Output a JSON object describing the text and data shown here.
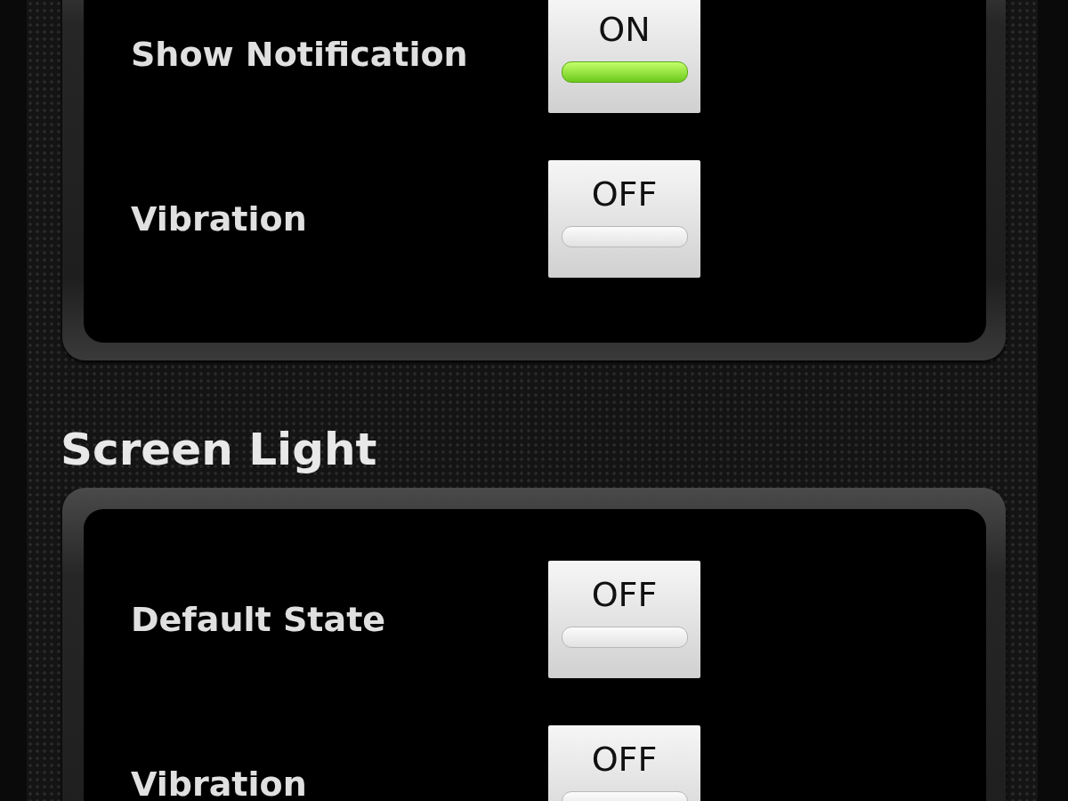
{
  "sections": [
    {
      "rows": [
        {
          "label": "Show Notification",
          "toggle_text": "ON",
          "on": true
        },
        {
          "label": "Vibration",
          "toggle_text": "OFF",
          "on": false
        }
      ]
    },
    {
      "title": "Screen Light",
      "rows": [
        {
          "label": "Default State",
          "toggle_text": "OFF",
          "on": false
        },
        {
          "label": "Vibration",
          "toggle_text": "OFF",
          "on": false
        }
      ]
    }
  ]
}
